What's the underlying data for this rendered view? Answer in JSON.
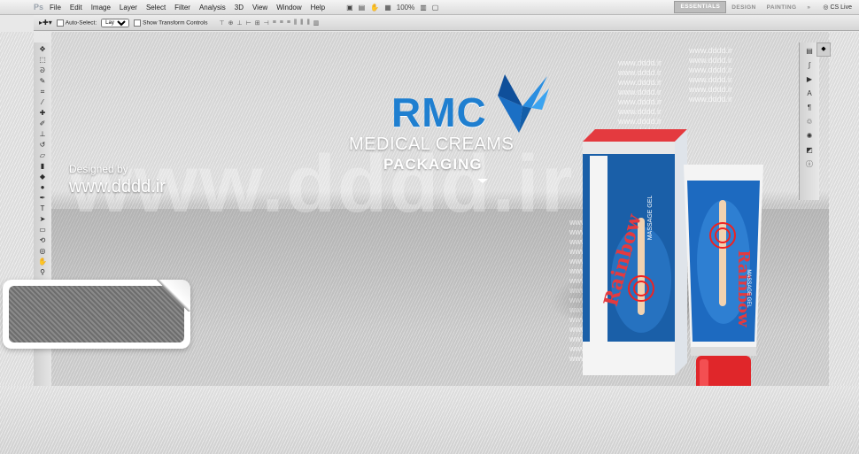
{
  "menubar": {
    "app_logo": "Ps",
    "items": [
      "File",
      "Edit",
      "Image",
      "Layer",
      "Select",
      "Filter",
      "Analysis",
      "3D",
      "View",
      "Window",
      "Help"
    ],
    "zoom": "100%",
    "workspaces": [
      "ESSENTIALS",
      "DESIGN",
      "PAINTING"
    ],
    "more": "»",
    "cs_live": "CS Live"
  },
  "options_bar": {
    "auto_select_label": "Auto-Select:",
    "auto_select_value": "Layer",
    "show_transform_label": "Show Transform Controls"
  },
  "canvas": {
    "logo": "RMC",
    "tagline_1": "MEDICAL CREAMS",
    "tagline_2": "PACKAGING",
    "designed_by": "Designed by",
    "website": "www.dddd.ir",
    "watermark": "www.dddd.ir",
    "product_name": "Rainbow",
    "product_type": "MASSAGE GEL"
  },
  "colors": {
    "logo_blue": "#1f7fd0",
    "box_blue": "#1a5fa8",
    "cap_red": "#e0262a"
  }
}
